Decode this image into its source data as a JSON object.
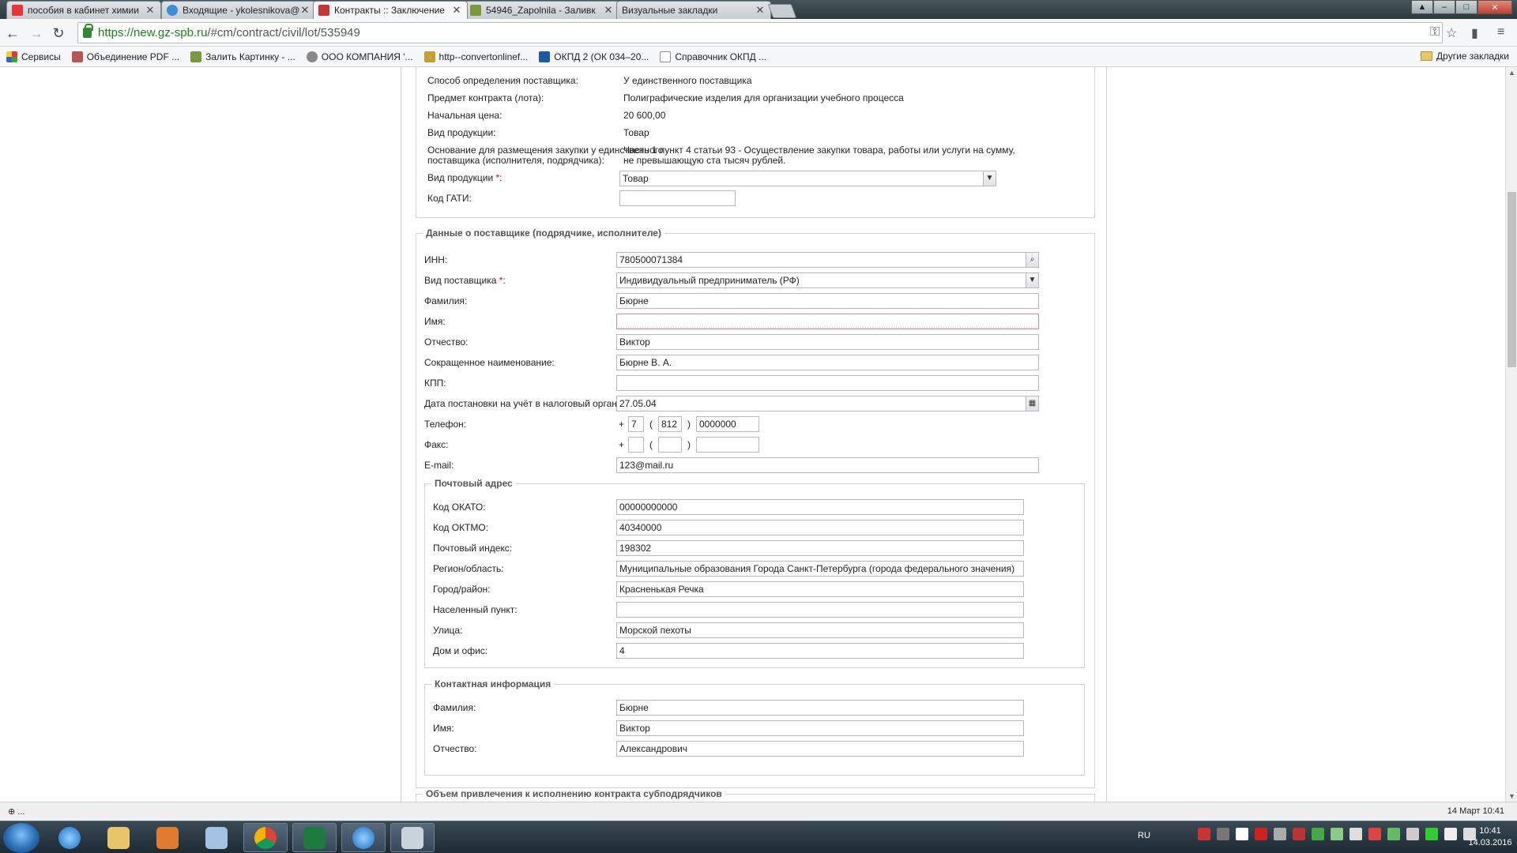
{
  "browser": {
    "tabs": [
      {
        "title": "пособия в кабинет химии",
        "active": false
      },
      {
        "title": "Входящие - ykolesnikova@",
        "active": false
      },
      {
        "title": "Контракты :: Заключение",
        "active": true
      },
      {
        "title": "54946_Zapolnila - Заливк",
        "active": false
      },
      {
        "title": "Визуальные закладки",
        "active": false
      }
    ],
    "url_scheme": "https://",
    "url_host": "new.gz-spb.ru",
    "url_path": "/#cm/contract/civil/lot/535949",
    "bookmarks": [
      "Сервисы",
      "Объединение PDF ...",
      "Залить Картинку - ...",
      "ООО КОМПАНИЯ '...",
      "http--convertonlinef...",
      "ОКПД 2 (ОК 034–20...",
      "Справочник ОКПД ..."
    ],
    "other_bookmarks": "Другие закладки"
  },
  "lot_info": {
    "rows": [
      {
        "label": "Способ определения поставщика:",
        "value": "У единственного поставщика"
      },
      {
        "label": "Предмет контракта (лота):",
        "value": "Полиграфические изделия для организации учебного процесса"
      },
      {
        "label": "Начальная цена:",
        "value": "20 600,00"
      },
      {
        "label": "Вид продукции:",
        "value": "Товар"
      }
    ],
    "basis_label_1": "Основание для размещения закупки у единственного",
    "basis_label_2": "поставщика (исполнителя, подрядчика):",
    "basis_value_1": "Часть 1 пункт 4 статьи 93 - Осуществление закупки товара, работы или услуги на сумму,",
    "basis_value_2": "не превышающую ста тысяч рублей.",
    "product_type_label": "Вид продукции",
    "product_type_value": "Товар",
    "gati_label": "Код ГАТИ:",
    "gati_value": ""
  },
  "supplier": {
    "legend": "Данные о поставщике (подрядчике, исполнителе)",
    "inn_label": "ИНН:",
    "inn_value": "780500071384",
    "type_label": "Вид поставщика",
    "type_value": "Индивидуальный предприниматель (РФ)",
    "surname_label": "Фамилия:",
    "surname_value": "Бюрне",
    "name_label": "Имя:",
    "name_value": "",
    "patronymic_label": "Отчество:",
    "patronymic_value": "Виктор",
    "short_name_label": "Сокращенное наименование:",
    "short_name_value": "Бюрне  В. А.",
    "kpp_label": "КПП:",
    "kpp_value": "",
    "tax_date_label": "Дата постановки на учёт в налоговый орган:",
    "tax_date_value": "27.05.04",
    "phone_label": "Телефон:",
    "phone_country": "7",
    "phone_code": "812",
    "phone_number": "0000000",
    "fax_label": "Факс:",
    "fax_country": "",
    "fax_code": "",
    "fax_number": "",
    "plus": "+",
    "paren_open": "(",
    "paren_close": ")",
    "email_label": "E-mail:",
    "email_value": "123@mail.ru"
  },
  "postal": {
    "legend": "Почтовый адрес",
    "rows": [
      {
        "label": "Код ОКАТО:",
        "value": "00000000000"
      },
      {
        "label": "Код ОКТМО:",
        "value": "40340000"
      },
      {
        "label": "Почтовый индекс:",
        "value": "198302"
      },
      {
        "label": "Регион/область:",
        "value": "Муниципальные образования Города Санкт-Петербурга (города федерального значения)"
      },
      {
        "label": "Город/район:",
        "value": "Красненькая Речка"
      },
      {
        "label": "Населенный пункт:",
        "value": ""
      },
      {
        "label": "Улица:",
        "value": "Морской пехоты"
      },
      {
        "label": "Дом и офис:",
        "value": "4"
      }
    ]
  },
  "contact": {
    "legend": "Контактная информация",
    "rows": [
      {
        "label": "Фамилия:",
        "value": "Бюрне"
      },
      {
        "label": "Имя:",
        "value": "Виктор"
      },
      {
        "label": "Отчество:",
        "value": "Александрович"
      }
    ]
  },
  "subcontract": {
    "legend": "Объем привлечения к исполнению контракта субподрядчиков"
  },
  "status": {
    "left": "...",
    "right": "14 Март 10:41"
  },
  "taskbar": {
    "lang": "RU",
    "time": "10:41",
    "date": "14.03.2016"
  },
  "colors": {
    "required": "#dd0000",
    "url_host": "#1d7f1d",
    "taskbar": "#1d2a33"
  }
}
